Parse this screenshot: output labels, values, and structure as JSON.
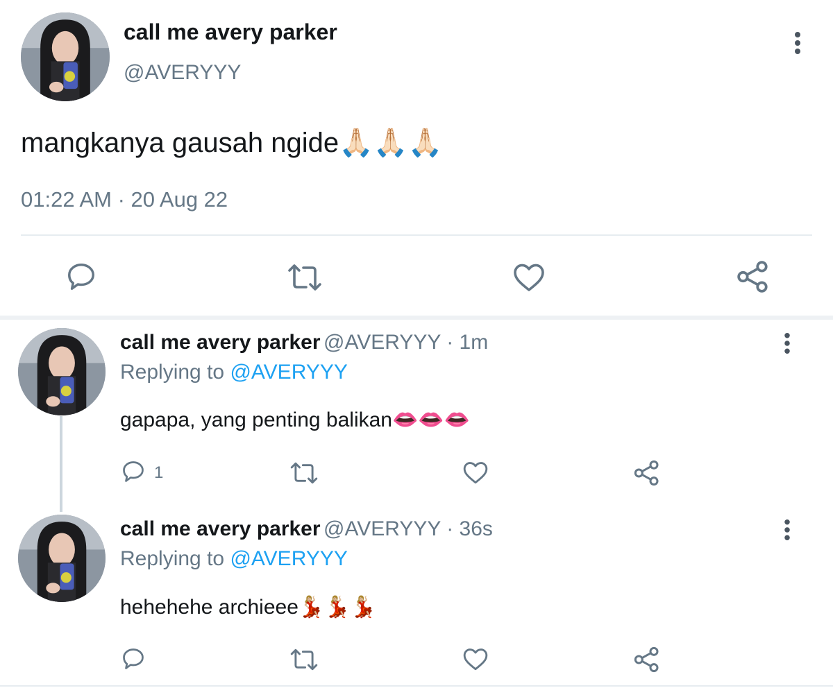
{
  "main_tweet": {
    "display_name": "call me avery parker",
    "handle": "@AVERYYY",
    "text": "mangkanya gausah ngide🙏🏻🙏🏻🙏🏻",
    "timestamp": "01:22 AM · 20 Aug 22",
    "actions": {
      "reply": "reply-icon",
      "retweet": "retweet-icon",
      "like": "heart-icon",
      "share": "share-icon"
    }
  },
  "replies": [
    {
      "display_name": "call me avery parker",
      "meta": "@AVERYYY · 1m",
      "replying_prefix": "Replying to ",
      "replying_to": "@AVERYYY",
      "text": "gapapa, yang penting balikan👄👄👄",
      "reply_count": "1"
    },
    {
      "display_name": "call me avery parker",
      "meta": "@AVERYYY · 36s",
      "replying_prefix": "Replying to ",
      "replying_to": "@AVERYYY",
      "text": "hehehehe archieee💃🏼💃🏼💃🏼"
    }
  ],
  "colors": {
    "text": "#14171a",
    "secondary": "#657786",
    "link": "#1da1f2",
    "divider": "#e6ecf0"
  }
}
